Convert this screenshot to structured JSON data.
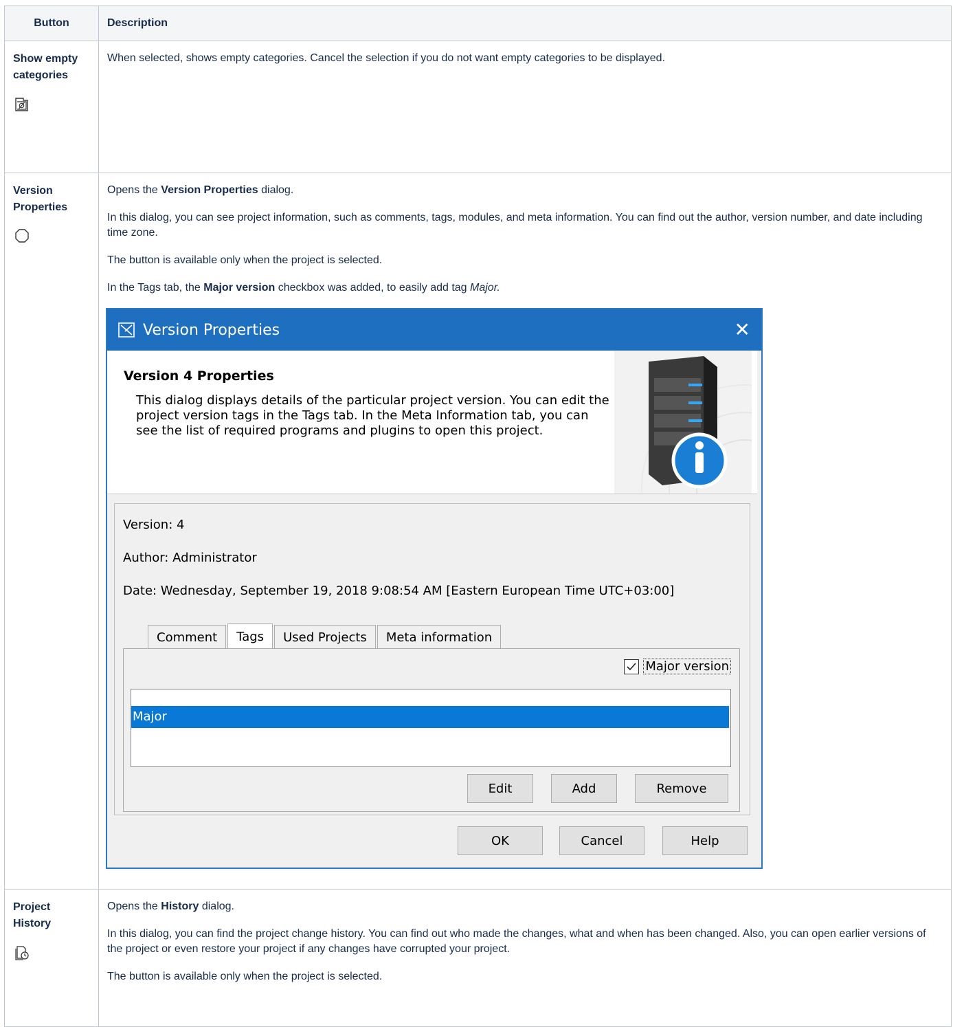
{
  "table": {
    "headers": [
      "Button",
      "Description"
    ],
    "rows": [
      {
        "name": "Show empty categories",
        "icon": "show-empty-categories-icon",
        "paragraphs": [
          "When selected, shows empty categories. Cancel the selection if you do not want empty categories to be displayed."
        ]
      },
      {
        "name": "Version Properties",
        "icon": "version-properties-icon",
        "p1_before": "Opens the ",
        "p1_bold": "Version Properties",
        "p1_after": " dialog.",
        "p2": "In this dialog, you can see project information, such as comments, tags, modules, and meta information. You can find out the author, version number, and date including time zone.",
        "p3": "The button is available only when the project is selected.",
        "p4_before": "In the Tags tab, the ",
        "p4_bold": "Major version",
        "p4_mid": " checkbox was added, to easily add tag ",
        "p4_italic": "Major."
      },
      {
        "name": "Project History",
        "icon": "project-history-icon",
        "p1_before": "Opens the ",
        "p1_bold": "History",
        "p1_after": " dialog.",
        "p2": "In this dialog, you can find the project change history. You can find out who made the changes, what and when has been changed. Also, you can open earlier versions of the project or even restore your project if any changes have corrupted your project.",
        "p3": "The button is available only when the project is selected."
      }
    ]
  },
  "dialog": {
    "title": "Version Properties",
    "close": "✕",
    "header_title": "Version 4 Properties",
    "header_text": "This dialog displays details of the particular project version. You can edit the project version tags in the Tags tab. In the Meta Information tab, you can see the list of required programs and plugins to open this project.",
    "version": "Version: 4",
    "author": "Author: Administrator",
    "date": "Date: Wednesday, September 19, 2018 9:08:54 AM [Eastern European Time UTC+03:00]",
    "tabs": [
      "Comment",
      "Tags",
      "Used Projects",
      "Meta information"
    ],
    "active_tab": "Tags",
    "major_checkbox": "Major version",
    "major_checked": true,
    "tags": [
      "Major"
    ],
    "panel_buttons": [
      "Edit",
      "Add",
      "Remove"
    ],
    "footer_buttons": [
      "OK",
      "Cancel",
      "Help"
    ],
    "colors": {
      "titlebar": "#1f6fc1",
      "selection": "#0a78d7"
    }
  }
}
